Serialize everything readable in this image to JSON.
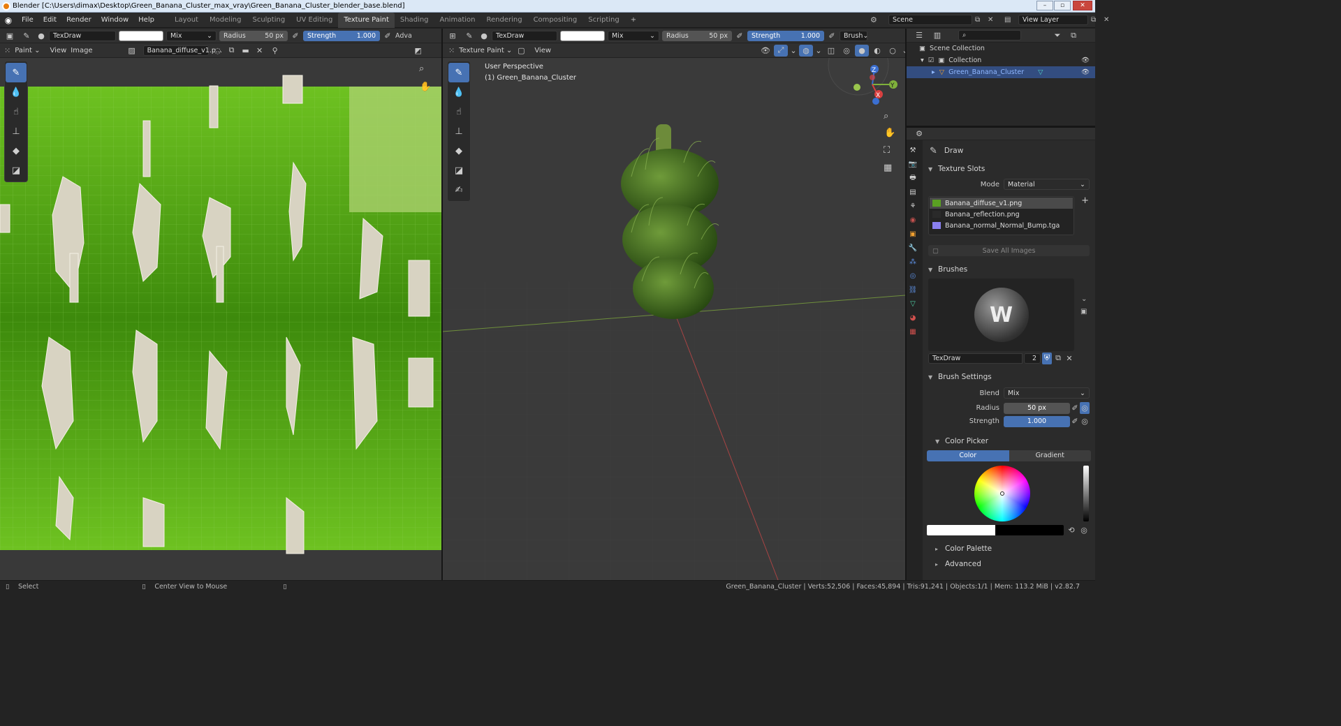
{
  "window": {
    "title": "Blender [C:\\Users\\dimax\\Desktop\\Green_Banana_Cluster_max_vray\\Green_Banana_Cluster_blender_base.blend]",
    "min": "–",
    "max": "▫",
    "close": "✕"
  },
  "menu": [
    "File",
    "Edit",
    "Render",
    "Window",
    "Help"
  ],
  "workspaces": [
    "Layout",
    "Modeling",
    "Sculpting",
    "UV Editing",
    "Texture Paint",
    "Shading",
    "Animation",
    "Rendering",
    "Compositing",
    "Scripting"
  ],
  "active_workspace": "Texture Paint",
  "add_workspace": "+",
  "scene": {
    "label": "Scene",
    "view_layer": "View Layer"
  },
  "image_editor": {
    "tool_settings": {
      "brush": "TexDraw",
      "blend": "Mix",
      "radius_label": "Radius",
      "radius_value": "50 px",
      "strength_label": "Strength",
      "strength_value": "1.000",
      "advanced": "Adva"
    },
    "header": {
      "mode": "Paint",
      "view": "View",
      "image": "Image",
      "image_name": "Banana_diffuse_v1.p..."
    }
  },
  "viewport": {
    "tool_settings": {
      "brush": "TexDraw",
      "blend": "Mix",
      "radius_label": "Radius",
      "radius_value": "50 px",
      "strength_label": "Strength",
      "strength_value": "1.000",
      "brush_menu": "Brush"
    },
    "header": {
      "mode": "Texture Paint",
      "view": "View"
    },
    "overlay_line1": "User Perspective",
    "overlay_line2": "(1) Green_Banana_Cluster",
    "gizmo": {
      "x": "X",
      "y": "Y",
      "z": "Z"
    }
  },
  "outliner": {
    "scene_collection": "Scene Collection",
    "collection": "Collection",
    "object": "Green_Banana_Cluster"
  },
  "properties": {
    "tool_name": "Draw",
    "texture_slots": {
      "title": "Texture Slots",
      "mode_label": "Mode",
      "mode_value": "Material",
      "slots": [
        "Banana_diffuse_v1.png",
        "Banana_reflection.png",
        "Banana_normal_Normal_Bump.tga"
      ],
      "save_all": "Save All Images",
      "add": "+"
    },
    "brushes": {
      "title": "Brushes",
      "brush_name": "TexDraw",
      "users": "2"
    },
    "brush_settings": {
      "title": "Brush Settings",
      "blend_label": "Blend",
      "blend_value": "Mix",
      "radius_label": "Radius",
      "radius_value": "50 px",
      "strength_label": "Strength",
      "strength_value": "1.000"
    },
    "color_picker": {
      "title": "Color Picker",
      "tab_color": "Color",
      "tab_gradient": "Gradient"
    },
    "color_palette": "Color Palette",
    "advanced": "Advanced"
  },
  "status": {
    "select": "Select",
    "center_view": "Center View to Mouse",
    "stats": "Green_Banana_Cluster | Verts:52,506 | Faces:45,894 | Tris:91,241 | Objects:1/1 | Mem: 113.2 MiB | v2.82.7"
  },
  "colors": {
    "accent": "#4772b3",
    "uv_green": "#4fa012",
    "banana": "#3e6b1a"
  }
}
